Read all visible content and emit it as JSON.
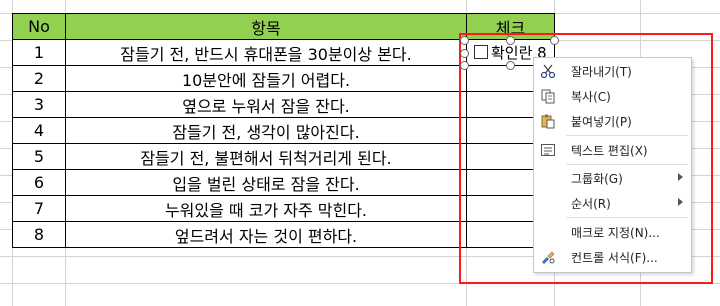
{
  "table": {
    "headers": [
      "No",
      "항목",
      "체크"
    ],
    "rows": [
      {
        "no": "1",
        "item": "잠들기 전, 반드시 휴대폰을 30분이상 본다."
      },
      {
        "no": "2",
        "item": "10분안에 잠들기 어렵다."
      },
      {
        "no": "3",
        "item": "옆으로 누워서 잠을 잔다."
      },
      {
        "no": "4",
        "item": "잠들기 전, 생각이 많아진다."
      },
      {
        "no": "5",
        "item": "잠들기 전, 불편해서 뒤척거리게 된다."
      },
      {
        "no": "6",
        "item": "입을 벌린 상태로 잠을 잔다."
      },
      {
        "no": "7",
        "item": "누워있을 때 코가 자주 막힌다."
      },
      {
        "no": "8",
        "item": "엎드려서 자는 것이 편하다."
      }
    ]
  },
  "checkbox": {
    "label": "확인란 8"
  },
  "context_menu": {
    "cut": "잘라내기(T)",
    "copy": "복사(C)",
    "paste": "붙여넣기(P)",
    "edit_text": "텍스트 편집(X)",
    "group": "그룹화(G)",
    "order": "순서(R)",
    "assign_macro": "매크로 지정(N)...",
    "format_control": "컨트롤 서식(F)..."
  },
  "colors": {
    "header_bg": "#92d050",
    "highlight_border": "#ff1a1a"
  }
}
